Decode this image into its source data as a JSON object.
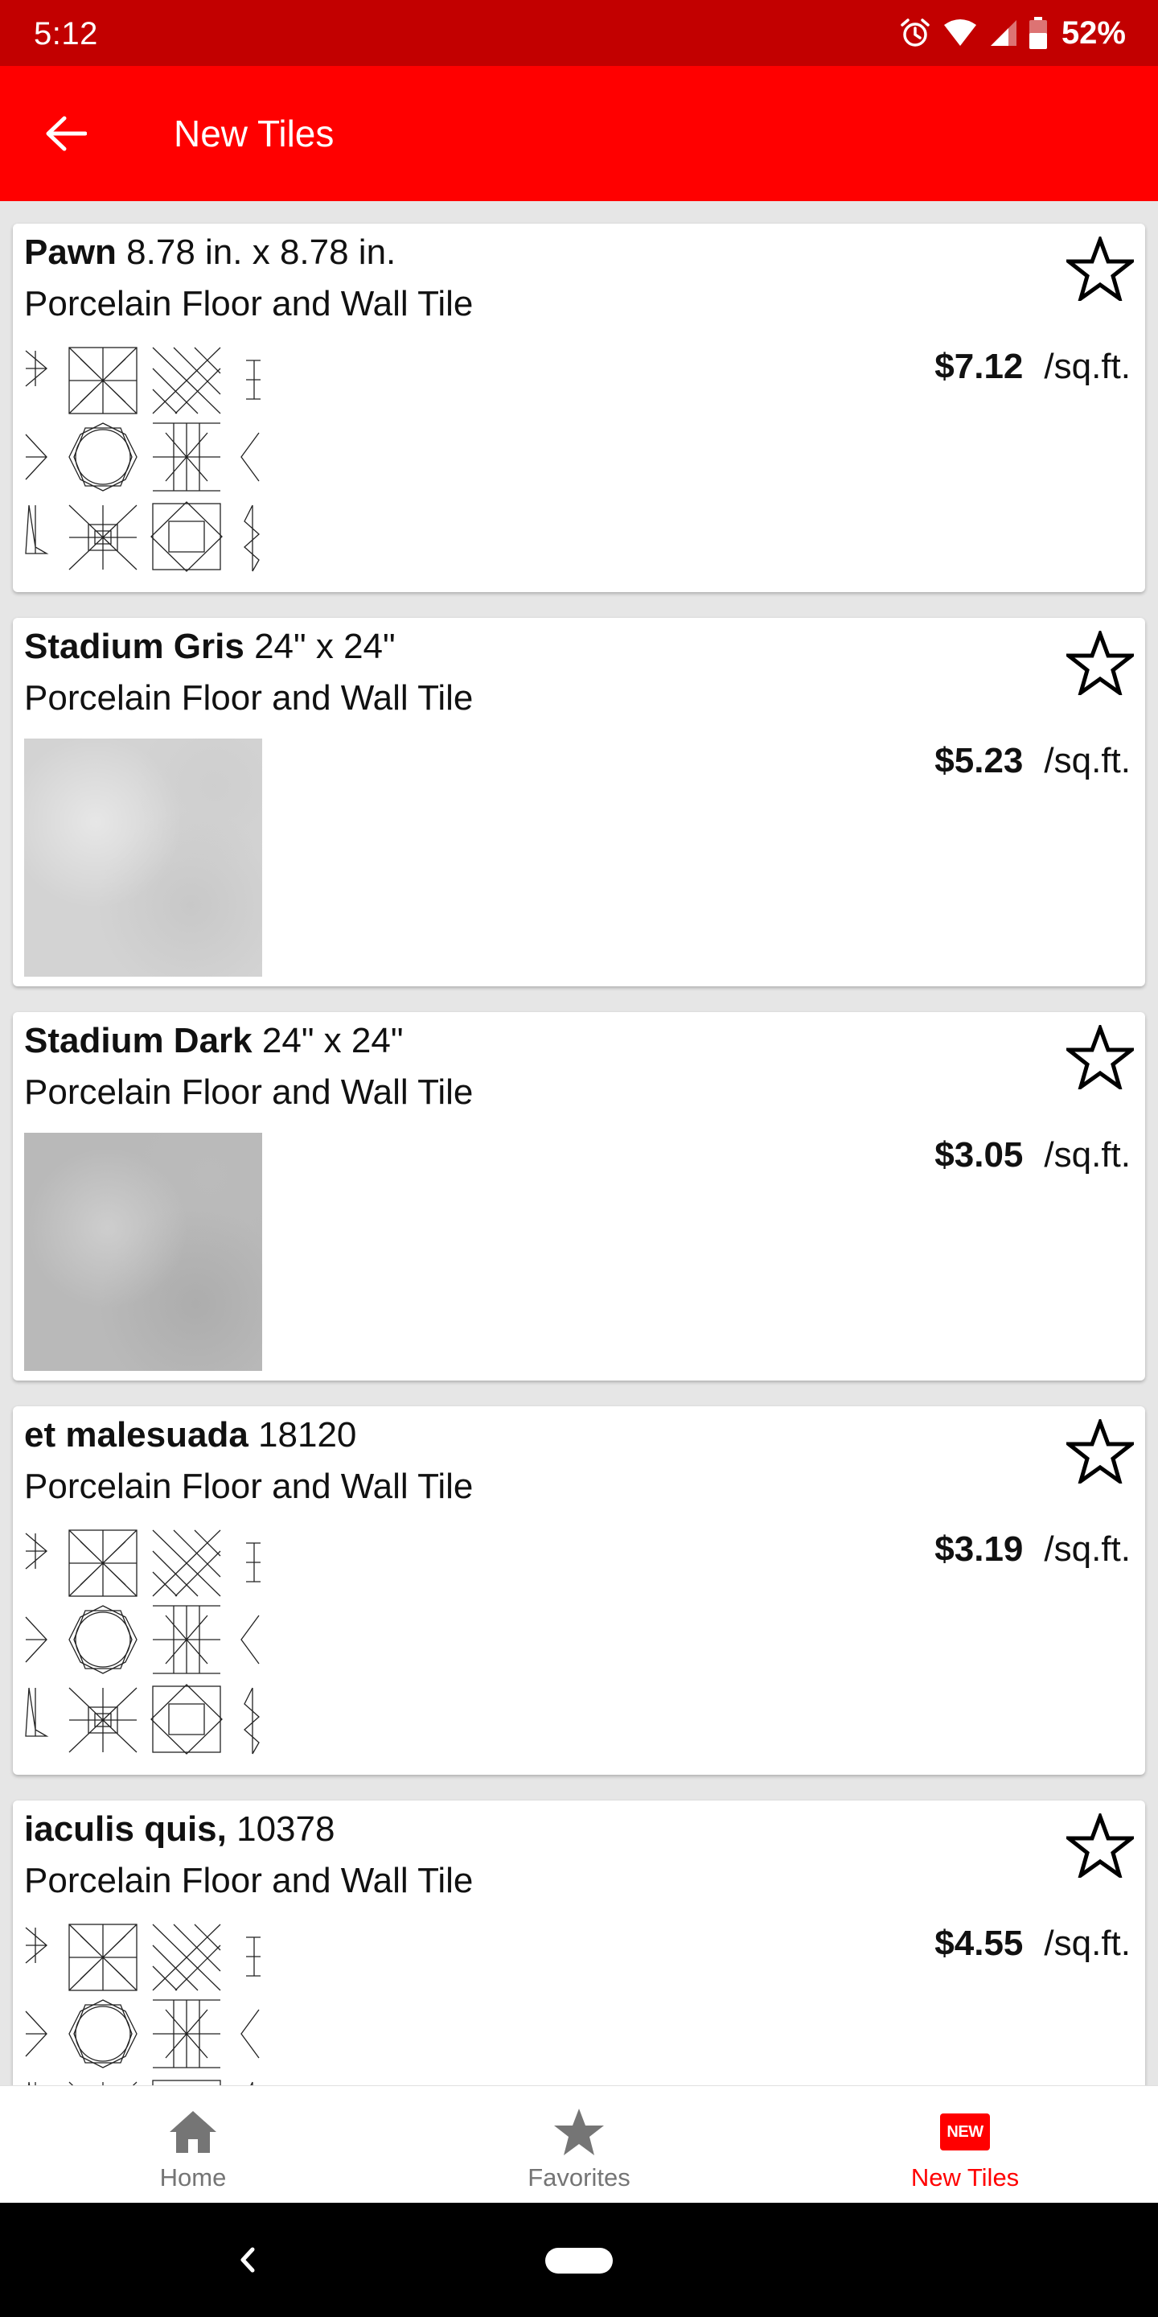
{
  "status_bar": {
    "time": "5:12",
    "battery": "52%",
    "icons": [
      "alarm-icon",
      "wifi-icon",
      "signal-icon",
      "battery-icon"
    ]
  },
  "app_bar": {
    "title": "New Tiles",
    "back_icon": "arrow-left-icon"
  },
  "colors": {
    "status_bar": "#c20000",
    "app_bar": "#ff0000",
    "accent": "#ff0000",
    "inactive": "#757575"
  },
  "products": [
    {
      "name": "Pawn",
      "size": "8.78 in. x 8.78 in.",
      "type": "Porcelain Floor and Wall Tile",
      "price": "$7.12",
      "unit": "/sq.ft.",
      "thumbnail": "pattern"
    },
    {
      "name": "Stadium Gris",
      "size": "24\" x 24\"",
      "type": "Porcelain Floor and Wall Tile",
      "price": "$5.23",
      "unit": "/sq.ft.",
      "thumbnail": "light-gray"
    },
    {
      "name": "Stadium Dark",
      "size": "24\" x 24\"",
      "type": "Porcelain Floor and Wall Tile",
      "price": "$3.05",
      "unit": "/sq.ft.",
      "thumbnail": "dark-gray"
    },
    {
      "name": "et malesuada",
      "size": "18120",
      "type": "Porcelain Floor and Wall Tile",
      "price": "$3.19",
      "unit": "/sq.ft.",
      "thumbnail": "pattern"
    },
    {
      "name": "iaculis quis,",
      "size": "10378",
      "type": "Porcelain Floor and Wall Tile",
      "price": "$4.55",
      "unit": "/sq.ft.",
      "thumbnail": "pattern"
    }
  ],
  "bottom_nav": {
    "items": [
      {
        "label": "Home",
        "icon": "home-icon",
        "active": false
      },
      {
        "label": "Favorites",
        "icon": "star-icon",
        "active": false
      },
      {
        "label": "New Tiles",
        "icon": "new-badge-icon",
        "badge_text": "NEW",
        "active": true
      }
    ]
  },
  "system_nav": {
    "icons": [
      "back-triangle-icon",
      "home-pill-icon"
    ]
  }
}
